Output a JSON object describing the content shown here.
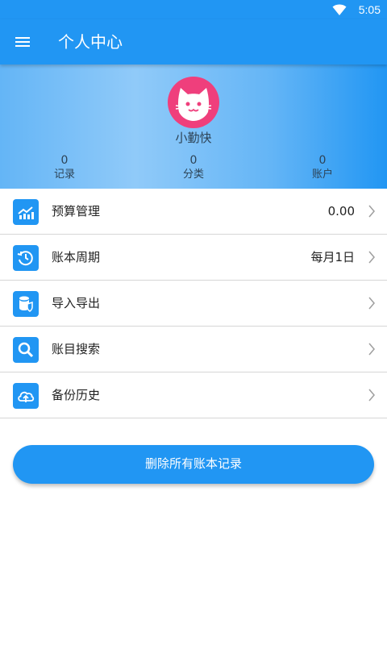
{
  "statusbar": {
    "time": "5:05",
    "wifi_icon": "wifi-icon"
  },
  "appbar": {
    "title": "个人中心",
    "menu_icon": "menu-icon"
  },
  "profile": {
    "username": "小勤快",
    "avatar_icon": "cat-face-icon",
    "avatar_color": "#ef3f7c",
    "stats": [
      {
        "value": "0",
        "label": "记录"
      },
      {
        "value": "0",
        "label": "分类"
      },
      {
        "value": "0",
        "label": "账户"
      }
    ]
  },
  "menu": [
    {
      "label": "预算管理",
      "value": "0.00",
      "icon": "chart-icon"
    },
    {
      "label": "账本周期",
      "value": "每月1日",
      "icon": "cycle-clock-icon"
    },
    {
      "label": "导入导出",
      "value": "",
      "icon": "database-shield-icon"
    },
    {
      "label": "账目搜索",
      "value": "",
      "icon": "search-icon"
    },
    {
      "label": "备份历史",
      "value": "",
      "icon": "cloud-upload-icon"
    }
  ],
  "delete_button": {
    "label": "删除所有账本记录"
  },
  "colors": {
    "primary": "#2196f3",
    "avatar": "#ef3f7c",
    "text": "#222222"
  }
}
